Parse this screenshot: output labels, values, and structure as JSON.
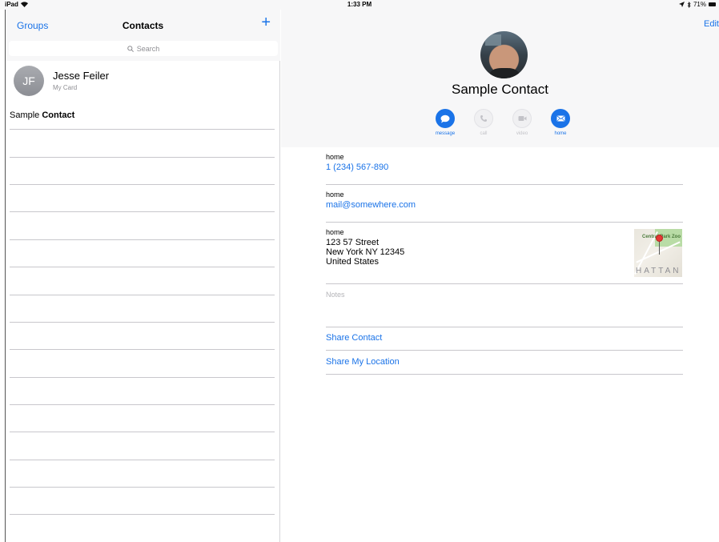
{
  "status_bar": {
    "device": "iPad",
    "time": "1:33 PM",
    "battery": "71%"
  },
  "left_panel": {
    "groups_label": "Groups",
    "title": "Contacts",
    "add_icon": "+",
    "search_placeholder": "Search",
    "my_card": {
      "initials": "JF",
      "name": "Jesse Feiler",
      "subtitle": "My Card"
    },
    "contacts": [
      {
        "first": "Sample",
        "last": "Contact"
      }
    ]
  },
  "detail": {
    "edit_label": "Edit",
    "name": "Sample Contact",
    "actions": [
      {
        "label": "message",
        "icon": "message-icon",
        "enabled": true
      },
      {
        "label": "call",
        "icon": "phone-icon",
        "enabled": false
      },
      {
        "label": "video",
        "icon": "video-icon",
        "enabled": false
      },
      {
        "label": "home",
        "icon": "mail-icon",
        "enabled": true
      }
    ],
    "phone": {
      "label": "home",
      "value": "1 (234) 567-890"
    },
    "email": {
      "label": "home",
      "value": "mail@somewhere.com"
    },
    "address": {
      "label": "home",
      "line1": "123 57 Street",
      "line2": "New York NY 12345",
      "line3": "United States"
    },
    "map": {
      "top_text": "Central Park Zoo",
      "bottom_text": "HATTAN"
    },
    "notes_placeholder": "Notes",
    "share_contact": "Share Contact",
    "share_location": "Share My Location"
  },
  "colors": {
    "accent": "#1a73e8",
    "separator": "#c8c7cc",
    "header_bg": "#f7f7f8"
  }
}
